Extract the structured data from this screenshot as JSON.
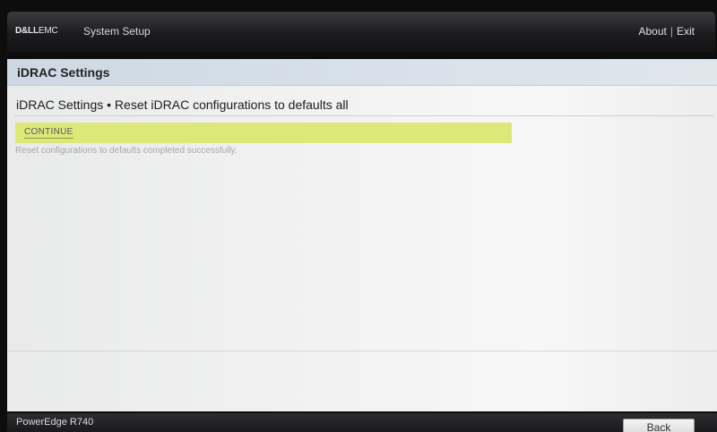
{
  "header": {
    "brand_bold": "D&LL",
    "brand_rest": "EMC",
    "title": "System Setup",
    "about_label": "About",
    "separator": "|",
    "exit_label": "Exit"
  },
  "panel": {
    "header": "iDRAC Settings",
    "subtitle": "iDRAC Settings • Reset iDRAC configurations to defaults all",
    "continue_label": "CONTINUE",
    "status": "Reset configurations to defaults completed successfully."
  },
  "footer": {
    "model": "PowerEdge R740",
    "back_label": "Back"
  },
  "colors": {
    "continue_highlight": "#dde878",
    "header_gradient": "#d9e2ea",
    "topbar": "#1c1c1f"
  }
}
